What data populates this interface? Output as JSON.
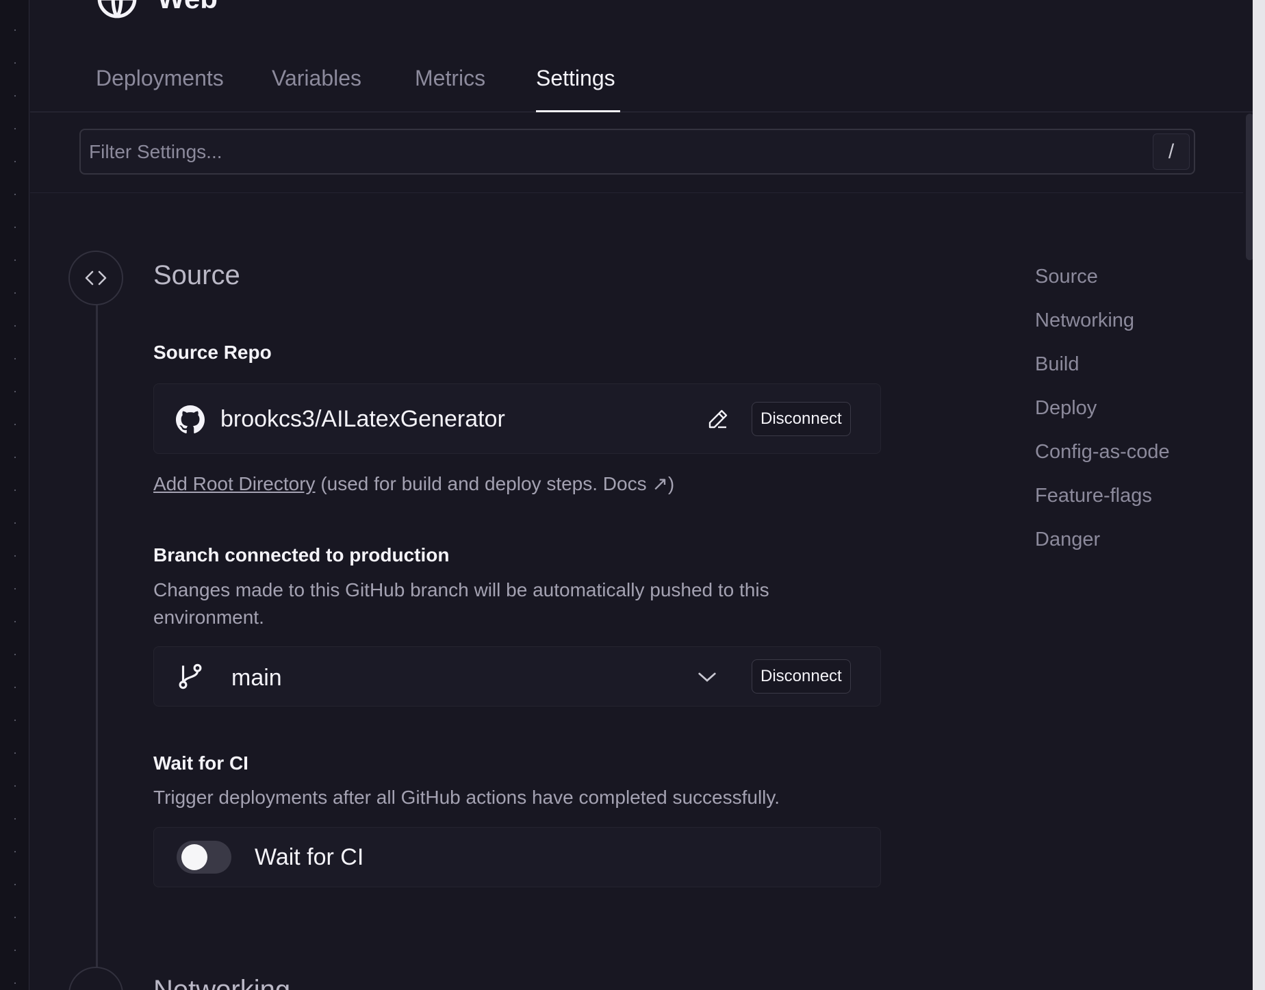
{
  "service": {
    "title": "Web",
    "icon": "globe-icon"
  },
  "tabs": [
    {
      "label": "Deployments"
    },
    {
      "label": "Variables"
    },
    {
      "label": "Metrics"
    },
    {
      "label": "Settings",
      "active": true
    }
  ],
  "filter": {
    "placeholder": "Filter Settings...",
    "shortcut": "/"
  },
  "section": {
    "title": "Source",
    "icon": "code-brackets-icon",
    "next_title": "Networking"
  },
  "source_repo": {
    "label": "Source Repo",
    "repo": "brookcs3/AILatexGenerator",
    "repo_icon": "github-icon",
    "edit_icon": "pencil-icon",
    "disconnect_label": "Disconnect",
    "root_dir_link": "Add Root Directory",
    "root_dir_note": "(used for build and deploy steps. Docs ↗)"
  },
  "branch": {
    "label": "Branch connected to production",
    "description": "Changes made to this GitHub branch will be automatically pushed to this environment.",
    "value": "main",
    "branch_icon": "git-branch-icon",
    "dropdown_icon": "chevron-down-icon",
    "disconnect_label": "Disconnect"
  },
  "wait_ci": {
    "label": "Wait for CI",
    "description": "Trigger deployments after all GitHub actions have completed successfully.",
    "toggle_label": "Wait for CI",
    "enabled": false
  },
  "right_nav": [
    {
      "label": "Source"
    },
    {
      "label": "Networking"
    },
    {
      "label": "Build"
    },
    {
      "label": "Deploy"
    },
    {
      "label": "Config-as-code"
    },
    {
      "label": "Feature-flags"
    },
    {
      "label": "Danger"
    }
  ]
}
